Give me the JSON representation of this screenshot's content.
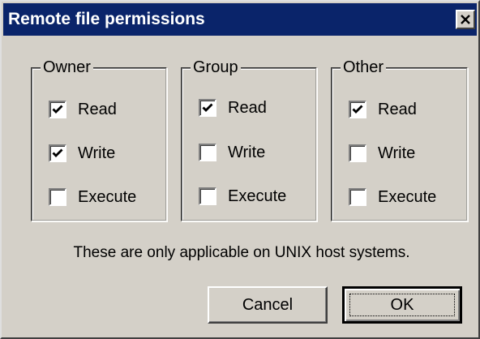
{
  "dialog": {
    "title": "Remote file permissions"
  },
  "groups": {
    "owner": {
      "label": "Owner",
      "read": {
        "label": "Read",
        "checked": true
      },
      "write": {
        "label": "Write",
        "checked": true
      },
      "execute": {
        "label": "Execute",
        "checked": false
      }
    },
    "group": {
      "label": "Group",
      "read": {
        "label": "Read",
        "checked": true
      },
      "write": {
        "label": "Write",
        "checked": false
      },
      "execute": {
        "label": "Execute",
        "checked": false
      }
    },
    "other": {
      "label": "Other",
      "read": {
        "label": "Read",
        "checked": true
      },
      "write": {
        "label": "Write",
        "checked": false
      },
      "execute": {
        "label": "Execute",
        "checked": false
      }
    }
  },
  "info_text": "These are only applicable on UNIX host systems.",
  "buttons": {
    "cancel": "Cancel",
    "ok": "OK"
  },
  "icons": {
    "close": "close-icon",
    "check": "checkmark-icon"
  },
  "colors": {
    "titlebar": "#0a246a",
    "face": "#d4d0c8"
  }
}
